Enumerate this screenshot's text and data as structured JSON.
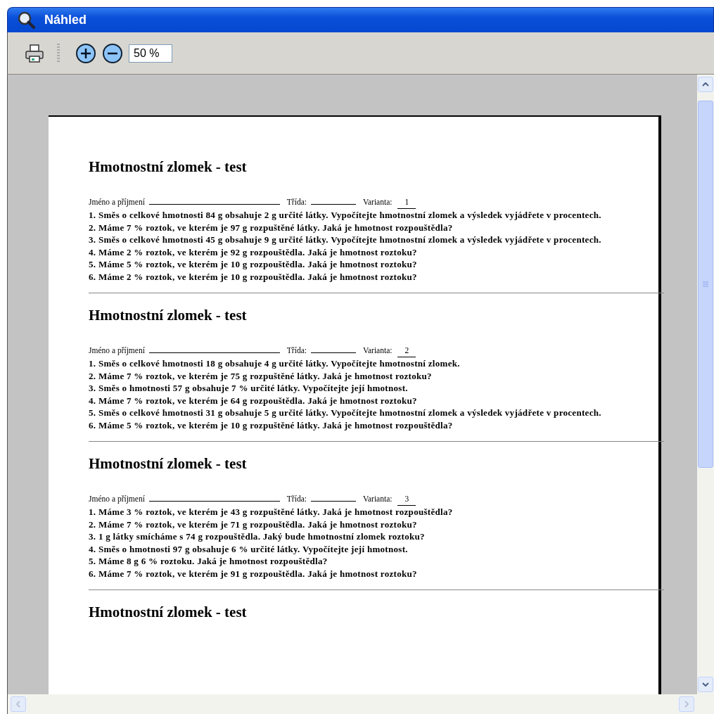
{
  "window": {
    "title": "Náhled"
  },
  "toolbar": {
    "zoom": "50 %"
  },
  "document": {
    "sections": [
      {
        "title": "Hmotnostní zlomek - test",
        "name_label": "Jméno a příjmení",
        "class_label": "Třída:",
        "variant_label": "Varianta:",
        "variant": "1",
        "questions": [
          "1. Směs o celkové hmotnosti 84 g obsahuje 2 g určité látky. Vypočítejte hmotnostní zlomek a výsledek vyjádřete v procentech.",
          "2. Máme 7 % roztok, ve kterém je 97 g rozpuštěné látky. Jaká je hmotnost rozpouštědla?",
          "3. Směs o celkové hmotnosti 45 g obsahuje 9 g určité látky. Vypočítejte hmotnostní zlomek a výsledek vyjádřete v procentech.",
          "4. Máme 2 % roztok, ve kterém je 92 g rozpouštědla. Jaká je hmotnost roztoku?",
          "5. Máme 5 % roztok, ve kterém je 10 g rozpouštědla. Jaká je hmotnost roztoku?",
          "6. Máme 2 % roztok, ve kterém je 10 g rozpouštědla. Jaká je hmotnost roztoku?"
        ]
      },
      {
        "title": "Hmotnostní zlomek - test",
        "name_label": "Jméno a příjmení",
        "class_label": "Třída:",
        "variant_label": "Varianta:",
        "variant": "2",
        "questions": [
          "1. Směs o celkové hmotnosti 18 g obsahuje 4 g určité látky. Vypočítejte hmotnostní zlomek.",
          "2. Máme 7 % roztok, ve kterém je 75 g rozpuštěné látky. Jaká je hmotnost roztoku?",
          "3. Směs o hmotnosti 57 g obsahuje 7 % určité látky. Vypočítejte její hmotnost.",
          "4. Máme 7 % roztok, ve kterém je 64 g rozpouštědla. Jaká je hmotnost roztoku?",
          "5. Směs o celkové hmotnosti 31 g obsahuje 5 g určité látky. Vypočítejte hmotnostní zlomek a výsledek vyjádřete v procentech.",
          "6. Máme 5 % roztok, ve kterém je 10 g rozpuštěné látky. Jaká je hmotnost rozpouštědla?"
        ]
      },
      {
        "title": "Hmotnostní zlomek - test",
        "name_label": "Jméno a příjmení",
        "class_label": "Třída:",
        "variant_label": "Varianta:",
        "variant": "3",
        "questions": [
          "1. Máme 3 % roztok, ve kterém je 43 g rozpuštěné látky. Jaká je hmotnost rozpouštědla?",
          "2. Máme 7 % roztok, ve kterém je 71 g rozpouštědla. Jaká je hmotnost roztoku?",
          "3. 1 g látky smícháme s 74 g rozpouštědla. Jaký bude hmotnostní zlomek roztoku?",
          "4. Směs o hmotnosti 97 g obsahuje 6 % určité látky. Vypočítejte její hmotnost.",
          "5. Máme 8 g 6 % roztoku. Jaká je hmotnost rozpouštědla?",
          "6. Máme 7 % roztok, ve kterém je 91 g rozpouštědla. Jaká je hmotnost roztoku?"
        ]
      },
      {
        "title": "Hmotnostní zlomek - test"
      }
    ]
  }
}
